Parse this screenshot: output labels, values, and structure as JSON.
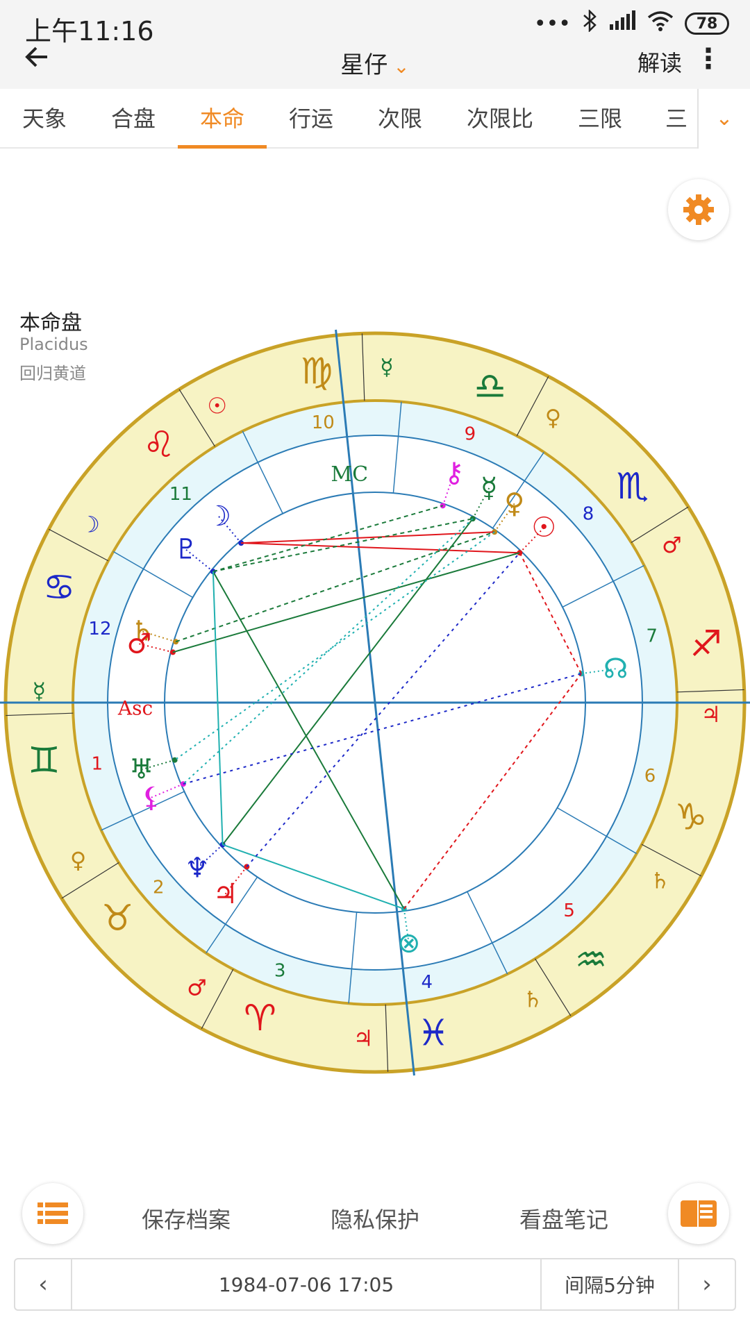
{
  "status_bar": {
    "time": "上午11:16",
    "battery": "78",
    "signal_dots": "•••"
  },
  "app_bar": {
    "back_icon": "arrow-left-icon",
    "title": "星仔",
    "title_caret": "⌄",
    "read_label": "解读",
    "more_icon": "⋮"
  },
  "tabs": [
    {
      "label": "天象",
      "active": false
    },
    {
      "label": "合盘",
      "active": false
    },
    {
      "label": "本命",
      "active": true
    },
    {
      "label": "行运",
      "active": false
    },
    {
      "label": "次限",
      "active": false
    },
    {
      "label": "次限比",
      "active": false
    },
    {
      "label": "三限",
      "active": false
    },
    {
      "label": "三",
      "active": false
    }
  ],
  "tab_more_icon": "⌄",
  "chart_info": {
    "title": "本命盘",
    "house_system": "Placidus",
    "zodiac": "回归黄道"
  },
  "colors": {
    "accent": "#f08a24",
    "outer_ring": "#f7f3c4",
    "inner_ring": "#e6f7fb",
    "ring_border": "#c9a227",
    "axis": "#2b7bb5"
  },
  "wheel": {
    "signs": [
      {
        "glyph": "♍",
        "color": "#c08a18",
        "rulers": [
          {
            "glyph": "☿",
            "color": "#1a7a3a"
          }
        ]
      },
      {
        "glyph": "♌",
        "color": "#e0161c",
        "rulers": [
          {
            "glyph": "☉",
            "color": "#e0161c"
          }
        ]
      },
      {
        "glyph": "♋",
        "color": "#1c28c8",
        "rulers": [
          {
            "glyph": "☽",
            "color": "#1c28c8"
          }
        ]
      },
      {
        "glyph": "♊",
        "color": "#1a7a3a",
        "rulers": [
          {
            "glyph": "☿",
            "color": "#1a7a3a"
          }
        ]
      },
      {
        "glyph": "♉",
        "color": "#c08a18",
        "rulers": [
          {
            "glyph": "♀",
            "color": "#c08a18"
          }
        ]
      },
      {
        "glyph": "♈",
        "color": "#e0161c",
        "rulers": [
          {
            "glyph": "♂",
            "color": "#e0161c"
          }
        ]
      },
      {
        "glyph": "♓",
        "color": "#1c28c8",
        "rulers": [
          {
            "glyph": "♃",
            "color": "#e0161c"
          }
        ]
      },
      {
        "glyph": "♒",
        "color": "#1a7a3a",
        "rulers": [
          {
            "glyph": "♄",
            "color": "#c08a18"
          }
        ]
      },
      {
        "glyph": "♑",
        "color": "#c08a18",
        "rulers": [
          {
            "glyph": "♄",
            "color": "#c08a18"
          }
        ]
      },
      {
        "glyph": "♐",
        "color": "#e0161c",
        "rulers": [
          {
            "glyph": "♃",
            "color": "#e0161c"
          }
        ]
      },
      {
        "glyph": "♏",
        "color": "#1c28c8",
        "rulers": [
          {
            "glyph": "♂",
            "color": "#e0161c"
          }
        ]
      },
      {
        "glyph": "♎",
        "color": "#1a7a3a",
        "rulers": [
          {
            "glyph": "♀",
            "color": "#c08a18"
          }
        ]
      }
    ],
    "houses": [
      {
        "number": "1",
        "color": "#e0161c"
      },
      {
        "number": "2",
        "color": "#c08a18"
      },
      {
        "number": "3",
        "color": "#1a7a3a"
      },
      {
        "number": "4",
        "color": "#1c28c8"
      },
      {
        "number": "5",
        "color": "#e0161c"
      },
      {
        "number": "6",
        "color": "#c08a18"
      },
      {
        "number": "7",
        "color": "#1a7a3a"
      },
      {
        "number": "8",
        "color": "#1c28c8"
      },
      {
        "number": "9",
        "color": "#e0161c"
      },
      {
        "number": "10",
        "color": "#c08a18"
      },
      {
        "number": "11",
        "color": "#1a7a3a"
      },
      {
        "number": "12",
        "color": "#1c28c8"
      }
    ],
    "angle_labels": [
      {
        "label": "MC",
        "color": "#1a7a3a"
      },
      {
        "label": "Asc",
        "color": "#e0161c"
      }
    ],
    "planets": [
      {
        "name": "Chiron",
        "glyph": "⚷",
        "color": "#e020e0"
      },
      {
        "name": "Mercury",
        "glyph": "☿",
        "color": "#1a7a3a"
      },
      {
        "name": "Venus",
        "glyph": "♀",
        "color": "#c08a18"
      },
      {
        "name": "Sun",
        "glyph": "☉",
        "color": "#e0161c"
      },
      {
        "name": "Node",
        "glyph": "☊",
        "color": "#20b0b0"
      },
      {
        "name": "Moon",
        "glyph": "☽",
        "color": "#1c28c8"
      },
      {
        "name": "Pluto",
        "glyph": "♇",
        "color": "#1c28c8"
      },
      {
        "name": "Saturn",
        "glyph": "♄",
        "color": "#c08a18"
      },
      {
        "name": "Mars",
        "glyph": "♂",
        "color": "#e0161c"
      },
      {
        "name": "Uranus",
        "glyph": "♅",
        "color": "#1a7a3a"
      },
      {
        "name": "Lilith",
        "glyph": "⚸",
        "color": "#e020e0"
      },
      {
        "name": "Neptune",
        "glyph": "♆",
        "color": "#1c28c8"
      },
      {
        "name": "Jupiter",
        "glyph": "♃",
        "color": "#e0161c"
      },
      {
        "name": "Fortune",
        "glyph": "⊗",
        "color": "#20b0b0"
      }
    ]
  },
  "bottom": {
    "list_icon": "list-icon",
    "save_label": "保存档案",
    "privacy_label": "隐私保护",
    "notes_label": "看盘笔记",
    "notebook_icon": "notebook-icon"
  },
  "datebar": {
    "prev": "‹",
    "datetime": "1984-07-06 17:05",
    "interval": "间隔5分钟",
    "next": "›"
  }
}
